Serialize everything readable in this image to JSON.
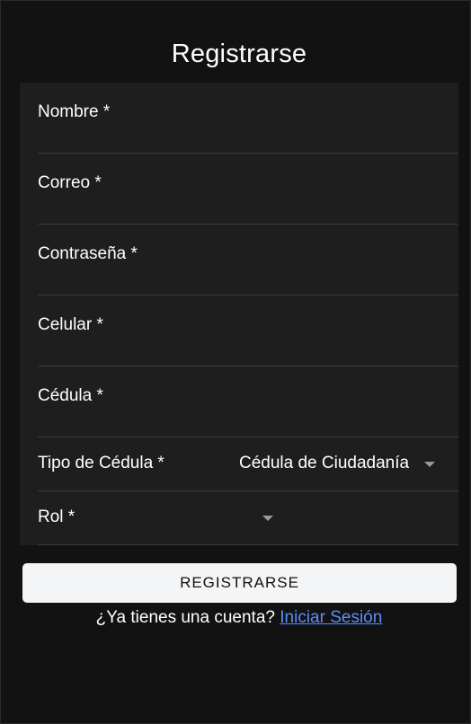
{
  "page": {
    "title": "Registrarse"
  },
  "form": {
    "fields": [
      {
        "label": "Nombre *",
        "value": ""
      },
      {
        "label": "Correo *",
        "value": ""
      },
      {
        "label": "Contraseña *",
        "value": ""
      },
      {
        "label": "Celular *",
        "value": ""
      },
      {
        "label": "Cédula *",
        "value": ""
      }
    ],
    "id_type": {
      "label": "Tipo de Cédula *",
      "selected": "Cédula de Ciudadanía"
    },
    "role": {
      "label": "Rol *",
      "selected": ""
    },
    "submit_label": "REGISTRARSE"
  },
  "footer": {
    "prompt": "¿Ya tienes una cuenta?",
    "login_link": "Iniciar Sesión"
  },
  "colors": {
    "background": "#121212",
    "card": "#1e1e1e",
    "divider": "#3a3a3a",
    "button": "#f4f5f7",
    "link": "#5b8cff"
  },
  "icons": {
    "select_caret": "caret-down-icon"
  }
}
